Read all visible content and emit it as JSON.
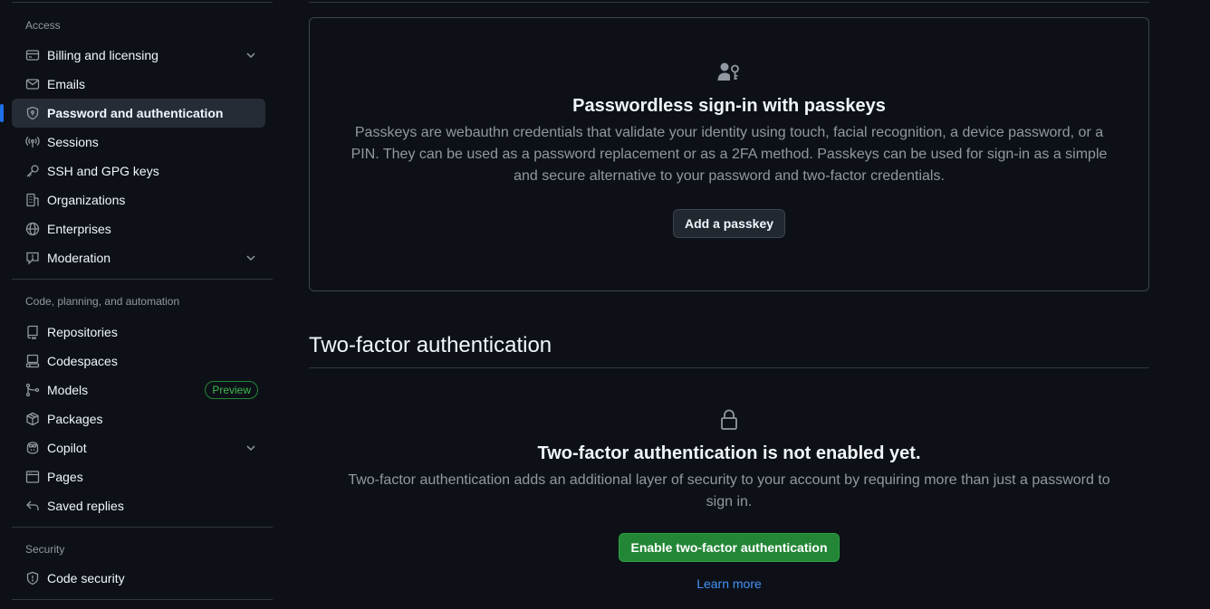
{
  "sidebar": {
    "access": {
      "title": "Access",
      "items": [
        {
          "label": "Billing and licensing",
          "icon": "credit-card-icon",
          "expandable": true
        },
        {
          "label": "Emails",
          "icon": "mail-icon"
        },
        {
          "label": "Password and authentication",
          "icon": "shield-lock-icon",
          "active": true
        },
        {
          "label": "Sessions",
          "icon": "broadcast-icon"
        },
        {
          "label": "SSH and GPG keys",
          "icon": "key-icon"
        },
        {
          "label": "Organizations",
          "icon": "organization-icon"
        },
        {
          "label": "Enterprises",
          "icon": "globe-icon"
        },
        {
          "label": "Moderation",
          "icon": "report-icon",
          "expandable": true
        }
      ]
    },
    "code": {
      "title": "Code, planning, and automation",
      "items": [
        {
          "label": "Repositories",
          "icon": "repo-icon"
        },
        {
          "label": "Codespaces",
          "icon": "codespaces-icon"
        },
        {
          "label": "Models",
          "icon": "models-icon",
          "badge": "Preview"
        },
        {
          "label": "Packages",
          "icon": "package-icon"
        },
        {
          "label": "Copilot",
          "icon": "copilot-icon",
          "expandable": true
        },
        {
          "label": "Pages",
          "icon": "browser-icon"
        },
        {
          "label": "Saved replies",
          "icon": "reply-icon"
        }
      ]
    },
    "security": {
      "title": "Security",
      "items": [
        {
          "label": "Code security",
          "icon": "shield-icon"
        }
      ]
    }
  },
  "passkeys": {
    "icon": "passkey-icon",
    "title": "Passwordless sign-in with passkeys",
    "description_lines": [
      "Passkeys are webauthn credentials that validate your identity using touch, facial recognition, a device password, or a",
      "PIN. They can be used as a password replacement or as a 2FA method. Passkeys can be used for sign-in as a simple",
      "and secure alternative to your password and two-factor credentials."
    ],
    "button_label": "Add a passkey"
  },
  "two_factor": {
    "heading": "Two-factor authentication",
    "icon": "lock-icon",
    "title": "Two-factor authentication is not enabled yet.",
    "description_lines": [
      "Two-factor authentication adds an additional layer of security to your account by requiring more than just a password to",
      "sign in."
    ],
    "button_label": "Enable two-factor authentication",
    "link_label": "Learn more"
  },
  "colors": {
    "background": "#0d1117",
    "accent": "#1f6feb",
    "primary_button": "#238636",
    "link": "#4493f8",
    "muted_text": "#9198a1"
  }
}
